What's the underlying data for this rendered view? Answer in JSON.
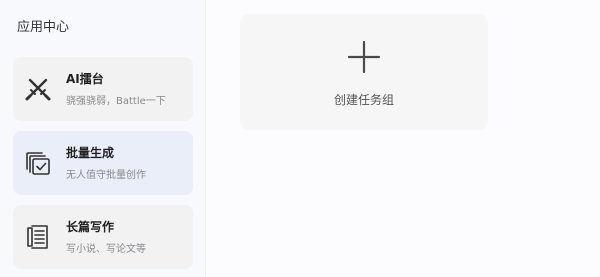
{
  "sidebar": {
    "title": "应用中心",
    "apps": [
      {
        "name": "AI擂台",
        "desc": "骁强骁弱，Battle一下",
        "icon": "crossed-swords-icon"
      },
      {
        "name": "批量生成",
        "desc": "无人值守批量创作",
        "icon": "batch-documents-icon",
        "active": true
      },
      {
        "name": "长篇写作",
        "desc": "写小说、写论文等",
        "icon": "long-document-icon"
      }
    ]
  },
  "main": {
    "create_task_group_label": "创建任务组",
    "create_icon": "plus-icon"
  },
  "colors": {
    "active_card": "#e9eef8",
    "card": "#f2f2f3",
    "icon": "#333333"
  }
}
